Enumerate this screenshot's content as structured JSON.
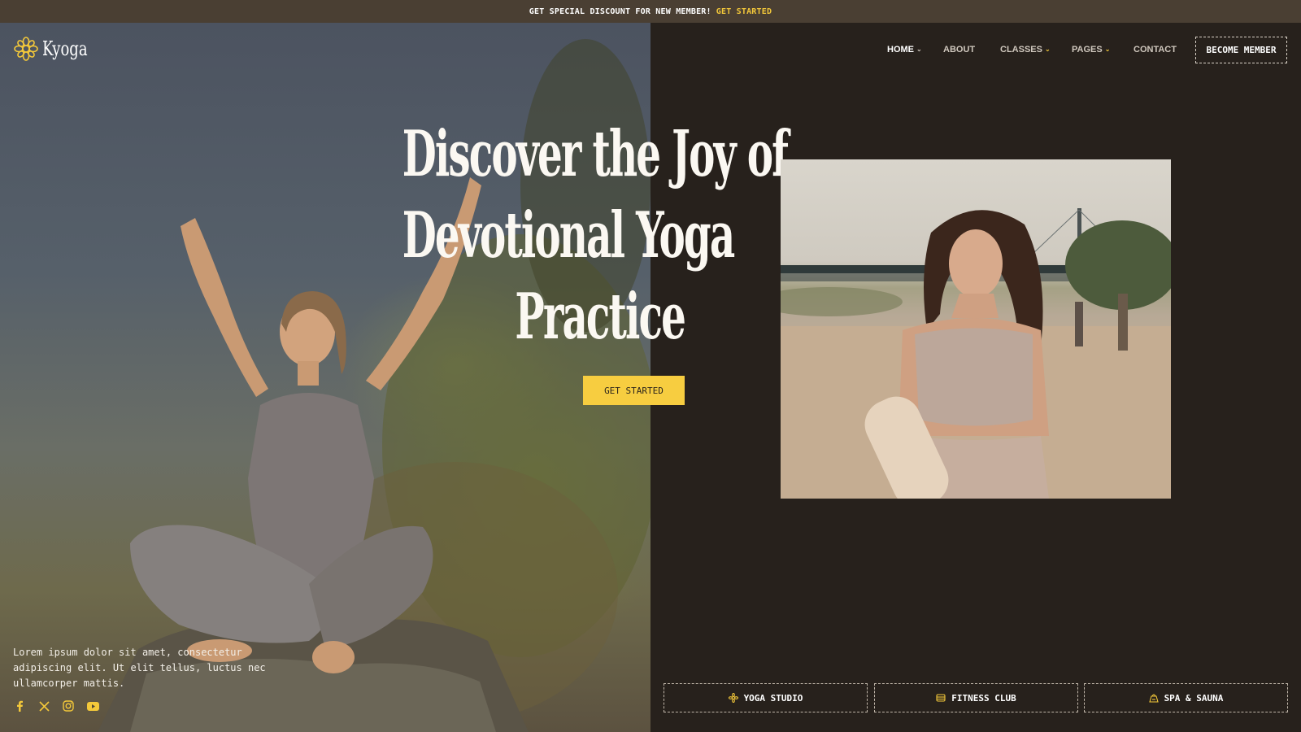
{
  "topbar": {
    "message": "GET SPECIAL DISCOUNT FOR NEW MEMBER!",
    "cta": "GET STARTED"
  },
  "brand": {
    "name": "Kyoga",
    "accent": "#f3c83a"
  },
  "nav": {
    "items": [
      {
        "label": "HOME",
        "has_dropdown": true
      },
      {
        "label": "ABOUT",
        "has_dropdown": false
      },
      {
        "label": "CLASSES",
        "has_dropdown": true
      },
      {
        "label": "PAGES",
        "has_dropdown": true
      },
      {
        "label": "CONTACT",
        "has_dropdown": false
      }
    ],
    "cta": "BECOME MEMBER"
  },
  "hero": {
    "headline_lines": [
      "Discover the Joy of",
      "Devotional Yoga",
      "Practice"
    ],
    "button": "GET STARTED",
    "description": "Lorem ipsum dolor sit amet, consectetur adipiscing elit. Ut elit tellus, luctus nec ullamcorper mattis.",
    "socials": [
      "facebook-icon",
      "x-icon",
      "instagram-icon",
      "youtube-icon"
    ]
  },
  "features": [
    {
      "label": "YOGA STUDIO",
      "icon": "lotus-icon"
    },
    {
      "label": "FITNESS CLUB",
      "icon": "dumbbell-icon"
    },
    {
      "label": "SPA & SAUNA",
      "icon": "spa-stones-icon"
    }
  ],
  "colors": {
    "background": "#27211c",
    "topbar": "#4a3f33",
    "accent": "#f3c83a",
    "button": "#f7cd40"
  }
}
